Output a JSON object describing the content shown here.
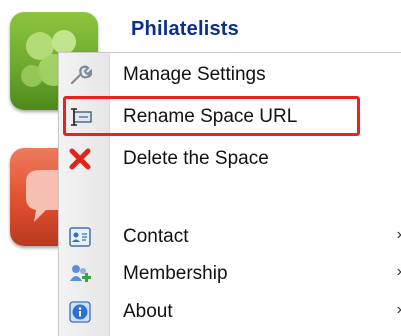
{
  "space": {
    "title": "Philatelists"
  },
  "menu": {
    "items": [
      {
        "label": "Manage Settings",
        "icon": "wrench-icon",
        "submenu": false
      },
      {
        "label": "Rename Space URL",
        "icon": "rename-icon",
        "submenu": false,
        "highlighted": true
      },
      {
        "label": "Delete the Space",
        "icon": "delete-x-icon",
        "submenu": false
      },
      {
        "label": "Contact",
        "icon": "contact-card-icon",
        "submenu": true
      },
      {
        "label": "Membership",
        "icon": "membership-icon",
        "submenu": true
      },
      {
        "label": "About",
        "icon": "info-icon",
        "submenu": true
      }
    ],
    "submenu_arrow": "›"
  },
  "colors": {
    "title": "#0a2f8f",
    "highlight": "#e8231e",
    "delete": "#e2231a"
  }
}
